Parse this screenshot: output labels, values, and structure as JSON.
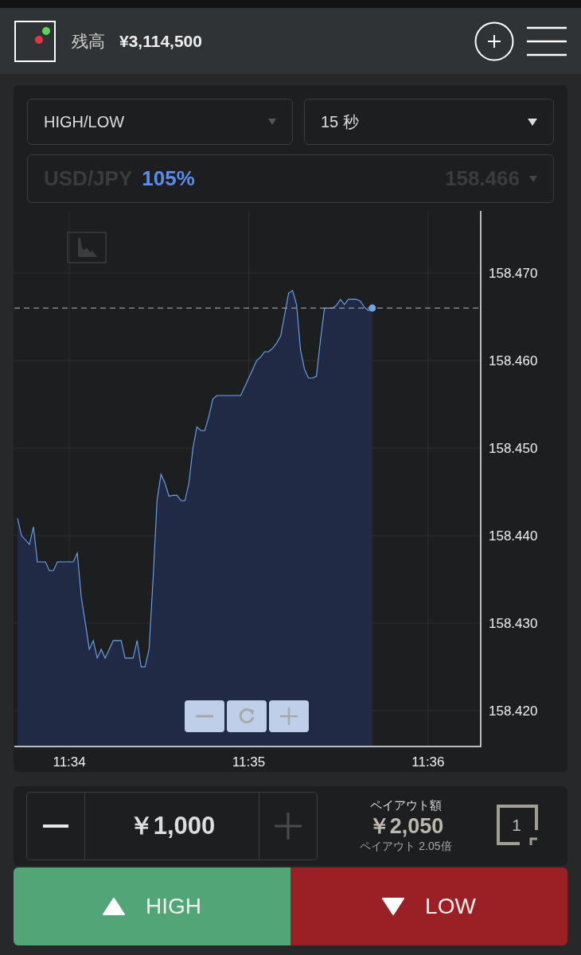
{
  "header": {
    "balance_label": "残高",
    "balance_value": "¥3,114,500"
  },
  "selectors": {
    "trade_type": "HIGH/LOW",
    "duration": "15 秒",
    "asset": {
      "name": "USD/JPY",
      "payout": "105%",
      "price": "158.466",
      "disabled": true
    }
  },
  "chart": {
    "chart_data": {
      "type": "area",
      "categories": [
        null,
        null,
        null,
        null,
        null,
        null,
        null,
        null,
        null,
        null,
        null,
        null,
        null,
        "11:34",
        null,
        null,
        null,
        null,
        null,
        null,
        null,
        null,
        null,
        null,
        null,
        null,
        null,
        null,
        null,
        null,
        null,
        null,
        null,
        null,
        null,
        null,
        null,
        null,
        null,
        null,
        null,
        null,
        null,
        null,
        null,
        null,
        null,
        null,
        null,
        null,
        null,
        null,
        null,
        null,
        null,
        null,
        null,
        null,
        "11:35",
        null,
        null,
        null,
        null,
        null,
        null,
        null,
        null,
        null,
        null,
        null,
        null,
        null,
        null,
        null,
        null,
        null,
        null,
        null,
        null,
        null,
        null,
        null,
        null,
        null,
        null,
        null,
        null,
        null,
        null,
        null,
        null,
        null,
        null,
        null,
        null,
        null,
        null,
        null,
        null,
        null,
        null,
        null,
        null,
        "11:36",
        null,
        null,
        null,
        null,
        null,
        null,
        null,
        null,
        null,
        null,
        null,
        null,
        null
      ],
      "series": [
        {
          "color": "#6ea6f5",
          "values": [
            158.442,
            158.44,
            158.4395,
            158.439,
            158.441,
            158.437,
            158.437,
            158.437,
            158.436,
            158.436,
            158.437,
            158.437,
            158.437,
            158.437,
            158.437,
            158.438,
            158.433,
            158.43,
            158.427,
            158.428,
            158.426,
            158.427,
            158.426,
            158.427,
            158.428,
            158.428,
            158.428,
            158.426,
            158.426,
            158.426,
            158.428,
            158.425,
            158.425,
            158.427,
            158.435,
            158.444,
            158.447,
            158.446,
            158.4445,
            158.4446,
            158.4446,
            158.444,
            158.444,
            158.446,
            158.45,
            158.4524,
            158.452,
            158.452,
            158.4536,
            158.4556,
            158.456,
            158.456,
            158.456,
            158.456,
            158.456,
            158.456,
            158.456,
            158.457,
            158.458,
            158.459,
            158.46,
            158.4604,
            158.461,
            158.461,
            158.4614,
            158.462,
            158.4628,
            158.4652,
            158.4677,
            158.468,
            158.4664,
            158.4612,
            158.459,
            158.458,
            158.458,
            158.4582,
            158.4624,
            158.466,
            158.466,
            158.466,
            158.4663,
            158.467,
            158.4664,
            158.467,
            158.467,
            158.467,
            158.4668,
            158.4661,
            158.4657,
            158.466,
            null,
            null,
            null,
            null,
            null,
            null,
            null,
            null,
            null,
            null,
            null,
            null,
            null,
            null,
            null,
            null,
            null,
            null,
            null,
            null,
            null,
            null,
            null,
            null,
            null,
            null,
            null
          ]
        }
      ],
      "ylim": [
        158.4159,
        158.4771
      ],
      "grid": true,
      "ref_lines": [
        {
          "axis": "y",
          "value": 158.466
        }
      ],
      "yticks": [
        {
          "value": 158.42,
          "label": "158.420"
        },
        {
          "value": 158.43,
          "label": "158.430"
        },
        {
          "value": 158.44,
          "label": "158.440"
        },
        {
          "value": 158.45,
          "label": "158.450"
        },
        {
          "value": 158.46,
          "label": "158.460"
        },
        {
          "value": 158.47,
          "label": "158.470"
        }
      ]
    }
  },
  "amount": {
    "value": "￥1,000",
    "minus_disabled": false,
    "plus_disabled": true
  },
  "payout": {
    "label": "ペイアウト額",
    "value": "￥2,050",
    "multiplier": "ペイアウト 2.05倍"
  },
  "one_click": {
    "count": "1"
  },
  "actions": [
    {
      "kind": "high",
      "label": "HIGH"
    },
    {
      "kind": "low",
      "label": "LOW"
    }
  ]
}
